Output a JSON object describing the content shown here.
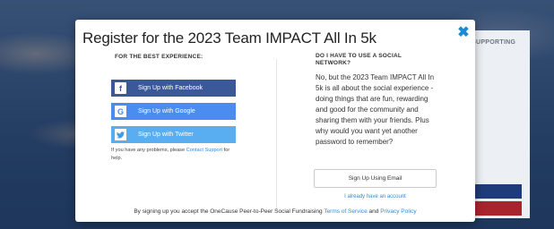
{
  "background": {
    "panel_label": "SUPPORTING"
  },
  "modal": {
    "title": "Register for the 2023 Team IMPACT All In 5k",
    "close_glyph": "✖",
    "left": {
      "heading": "FOR THE BEST EXPERIENCE:",
      "facebook": {
        "label": "Sign Up with Facebook",
        "icon": "facebook-icon",
        "color": "#3b5998"
      },
      "google": {
        "label": "Sign Up with Google",
        "icon": "google-icon",
        "color": "#4a8cf0"
      },
      "twitter": {
        "label": "Sign Up with Twitter",
        "icon": "twitter-icon",
        "color": "#58aef0"
      },
      "help_prefix": "If you have any problems, please ",
      "help_link": "Contact Support",
      "help_suffix": " for help."
    },
    "right": {
      "heading": "DO I HAVE TO USE A SOCIAL NETWORK?",
      "body": "No, but the 2023 Team IMPACT All In 5k is all about the social experience - doing things that are fun, rewarding and good for the community and sharing them with your friends. Plus why would you want yet another password to remember?",
      "email_button": "Sign Up Using Email",
      "account_link": "I already have an account"
    },
    "footer": {
      "prefix": "By signing up you accept the OneCause Peer-to-Peer Social Fundraising ",
      "terms": "Terms of Service",
      "and": " and ",
      "privacy": "Privacy Policy"
    }
  },
  "colors": {
    "link": "#2f8be0",
    "close": "#1a8ad4"
  }
}
